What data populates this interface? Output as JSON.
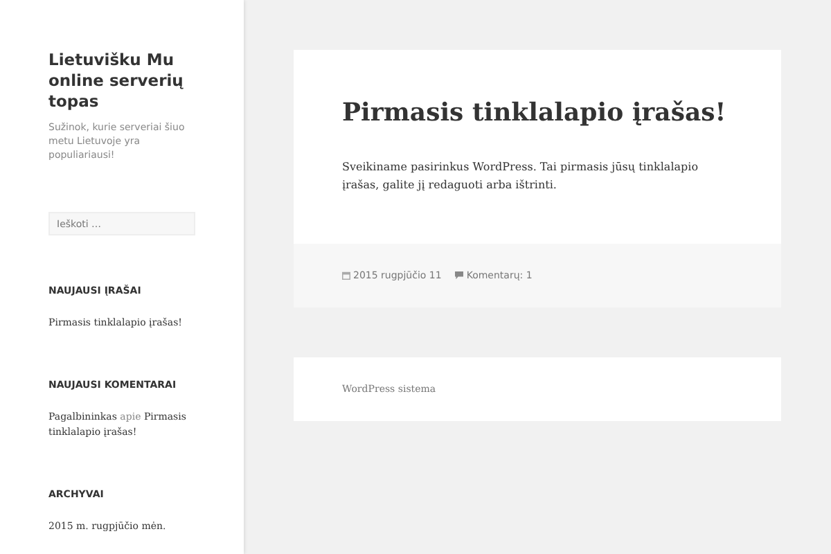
{
  "site": {
    "title": "Lietuvišku Mu online serverių topas",
    "tagline": "Sužinok, kurie serveriai šiuo metu Lietuvoje yra populiariausi!"
  },
  "search": {
    "placeholder": "Ieškoti …"
  },
  "widgets": [
    {
      "heading": "NAUJAUSI ĮRAŠAI",
      "kind": "links",
      "items": [
        "Pirmasis tinklalapio įrašas!"
      ]
    },
    {
      "heading": "NAUJAUSI KOMENTARAI",
      "kind": "comment",
      "author": "Pagalbininkas",
      "connector": "apie",
      "post": "Pirmasis tinklalapio įrašas!"
    },
    {
      "heading": "ARCHYVAI",
      "kind": "links",
      "items": [
        "2015 m. rugpjūčio mėn."
      ]
    }
  ],
  "post": {
    "title": "Pirmasis tinklalapio įrašas!",
    "body": "Sveikiname pasirinkus WordPress. Tai pirmasis jūsų tinklalapio įrašas, galite jį redaguoti arba ištrinti.",
    "date": "2015 rugpjūčio 11",
    "comments": "Komentarų: 1"
  },
  "footer": {
    "credit": "WordPress sistema"
  }
}
